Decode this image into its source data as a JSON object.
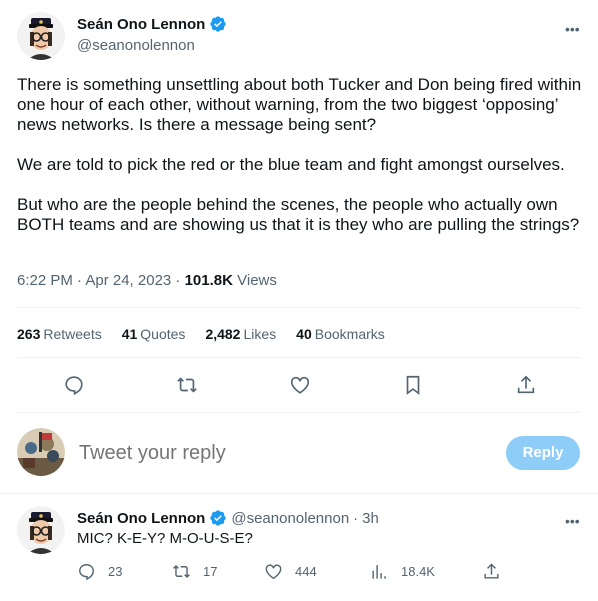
{
  "colors": {
    "accent": "#1d9bf0",
    "muted": "#536471",
    "text": "#0f1419",
    "reply_button_bg": "#8ecdf8"
  },
  "tweet": {
    "display_name": "Seán Ono Lennon",
    "handle": "@seanonolennon",
    "paragraphs": [
      "There is something unsettling about both Tucker and Don being fired within one hour of each other, without warning, from the two biggest ‘opposing’ news networks. Is there a message being sent?",
      "We are told to pick the red or the blue team and fight amongst ourselves.",
      "But who are the people behind the scenes, the people who actually own BOTH teams and are showing us that it is they who are pulling the strings?"
    ],
    "time": "6:22 PM · Apr 24, 2023 · ",
    "views_count": "101.8K",
    "views_label": " Views",
    "stats": [
      {
        "count": "263",
        "label": "Retweets"
      },
      {
        "count": "41",
        "label": "Quotes"
      },
      {
        "count": "2,482",
        "label": "Likes"
      },
      {
        "count": "40",
        "label": "Bookmarks"
      }
    ],
    "actions": [
      "reply-icon",
      "retweet-icon",
      "like-icon",
      "bookmark-icon",
      "share-icon"
    ]
  },
  "reply_composer": {
    "placeholder": "Tweet your reply",
    "button_label": "Reply"
  },
  "reply": {
    "display_name": "Seán Ono Lennon",
    "handle": "@seanonolennon",
    "separator": "·",
    "time": "3h",
    "text": "MIC? K-E-Y? M-O-U-S-E?",
    "replies": "23",
    "retweets": "17",
    "likes": "444",
    "views": "18.4K"
  }
}
